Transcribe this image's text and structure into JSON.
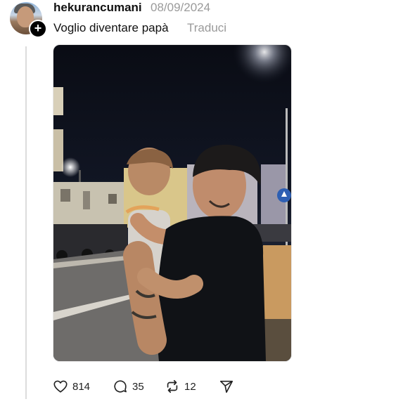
{
  "post": {
    "username": "hekurancumani",
    "date": "08/09/2024",
    "text": "Voglio diventare papà",
    "translate_label": "Traduci",
    "follow_icon": "plus-icon"
  },
  "media": {
    "kind": "photo",
    "subject": "man-holding-child-night-street"
  },
  "actions": {
    "likes": "814",
    "replies": "35",
    "reposts": "12",
    "like_icon": "heart-icon",
    "reply_icon": "comment-icon",
    "repost_icon": "repost-icon",
    "share_icon": "send-icon"
  }
}
